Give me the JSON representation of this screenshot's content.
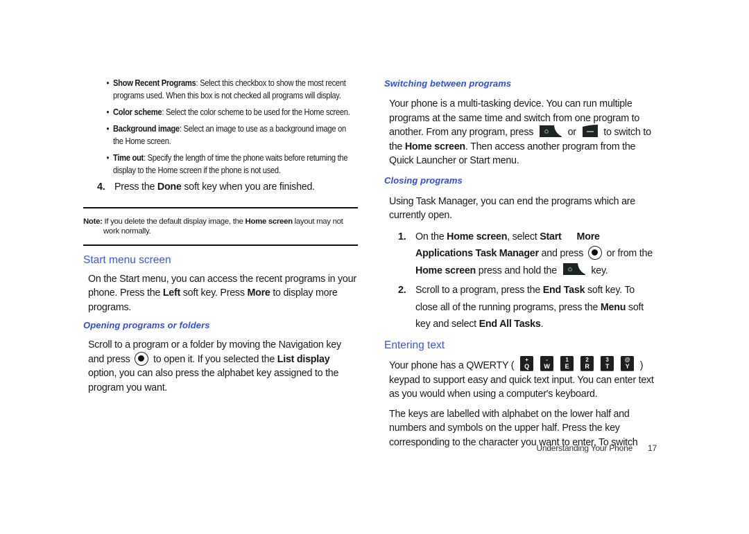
{
  "left_column": {
    "bullets": [
      {
        "term": "Show Recent Programs",
        "text": ": Select this checkbox to show the most recent programs used. When this box is not checked all programs will display."
      },
      {
        "term": "Color scheme",
        "text": ": Select the color scheme to be used for the Home screen."
      },
      {
        "term": "Background image",
        "text": ": Select an image to use as a background image on the Home screen."
      },
      {
        "term": "Time out",
        "text": ": Specify the length of time the phone waits before returning the display to the Home screen if the phone is not used."
      }
    ],
    "step4": {
      "num": "4.",
      "pre": "Press the ",
      "bold": "Done",
      "post": " soft key when you are finished."
    },
    "note": {
      "label": "Note:",
      "pre": " If you delete the default display image, the ",
      "bold": "Home screen",
      "post": " layout may not work normally."
    },
    "start_menu": {
      "heading": "Start menu screen",
      "p1": "On the Start menu, you can access the recent programs in your phone. Press the ",
      "b1": "Left",
      "p2": " soft key. Press ",
      "b2": "More",
      "p3": " to display more programs."
    },
    "opening": {
      "heading": "Opening programs or folders",
      "p1": "Scroll to a program or a folder by moving the Navigation key and press ",
      "p2": " to open it. If you selected the ",
      "b1": "List display",
      "p3": " option, you can also press the alphabet key assigned to the program you want."
    }
  },
  "right_column": {
    "switching": {
      "heading": "Switching between programs",
      "p1": "Your phone is a multi-tasking device. You can run multiple programs at the same time and switch from one program to another. From any program, press ",
      "or": " or ",
      "p2": " to switch to the ",
      "b1": "Home screen",
      "p3": ". Then access another program from the Quick Launcher or Start menu."
    },
    "closing": {
      "heading": "Closing programs",
      "intro": "Using Task Manager, you can end the programs which are currently open.",
      "step1": {
        "num": "1.",
        "t1": "On the ",
        "b1": "Home screen",
        "t2": ", select ",
        "b2": "Start",
        "b3": "More",
        "b4": "Applications",
        "b5": "Task Manager",
        "t3": " and press ",
        "t4": " or from the ",
        "b6": "Home screen",
        "t5": " press and hold the ",
        "t6": " key."
      },
      "step2": {
        "num": "2.",
        "t1": "Scroll to a program, press the ",
        "b1": "End Task",
        "t2": " soft key. To close all of the running programs, press the ",
        "b2": "Menu",
        "t3": " soft key and select ",
        "b3": "End All Tasks",
        "t4": "."
      }
    },
    "entering": {
      "heading": "Entering text",
      "p1": "Your phone has a QWERTY ( ",
      "keys": [
        {
          "upper": "+",
          "lower": "Q"
        },
        {
          "upper": "-",
          "lower": "W"
        },
        {
          "upper": "1",
          "lower": "E"
        },
        {
          "upper": "2",
          "lower": "R"
        },
        {
          "upper": "3",
          "lower": "T"
        },
        {
          "upper": "@",
          "lower": "Y"
        }
      ],
      "p2": " ) keypad to support easy and quick text input. You can enter text as you would when using a computer's keyboard.",
      "p3": "The keys are labelled with alphabet on the lower half and numbers and symbols on the upper half. Press the key corresponding to the character you want to enter. To switch"
    }
  },
  "footer": {
    "section": "Understanding Your Phone",
    "page": "17"
  },
  "colors": {
    "heading_blue": "#3a55f0",
    "subheading_blue": "#2f4de8",
    "text": "#1a1a1a"
  }
}
